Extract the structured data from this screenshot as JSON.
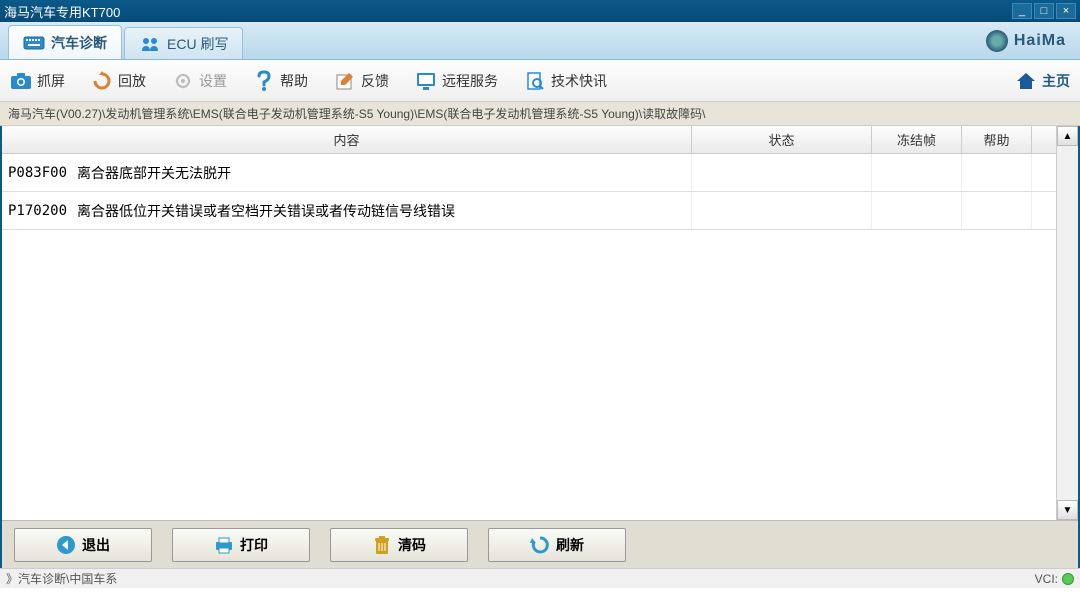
{
  "window": {
    "title": "海马汽车专用KT700"
  },
  "tabs": [
    {
      "label": "汽车诊断",
      "active": true
    },
    {
      "label": "ECU 刷写",
      "active": false
    }
  ],
  "brand": "HaiMa",
  "toolbar": {
    "screenshot": "抓屏",
    "playback": "回放",
    "settings": "设置",
    "help": "帮助",
    "feedback": "反馈",
    "remote": "远程服务",
    "news": "技术快讯",
    "home": "主页"
  },
  "breadcrumb": "海马汽车(V00.27)\\发动机管理系统\\EMS(联合电子发动机管理系统-S5 Young)\\EMS(联合电子发动机管理系统-S5 Young)\\读取故障码\\",
  "table": {
    "headers": {
      "content": "内容",
      "status": "状态",
      "freeze": "冻结帧",
      "help": "帮助"
    },
    "rows": [
      {
        "code": "P083F00",
        "desc": "离合器底部开关无法脱开",
        "status": "",
        "freeze": "",
        "help": ""
      },
      {
        "code": "P170200",
        "desc": "离合器低位开关错误或者空档开关错误或者传动链信号线错误",
        "status": "",
        "freeze": "",
        "help": ""
      }
    ]
  },
  "buttons": {
    "exit": "退出",
    "print": "打印",
    "clear": "清码",
    "refresh": "刷新"
  },
  "statusbar": {
    "path": "》汽车诊断\\中国车系",
    "vci": "VCI:"
  }
}
